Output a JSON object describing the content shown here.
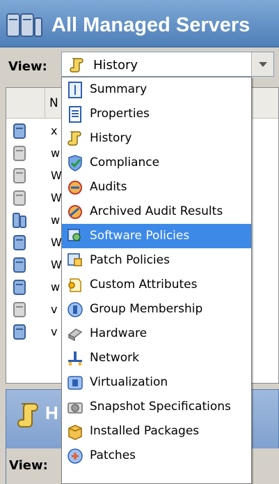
{
  "header": {
    "title": "All Managed Servers"
  },
  "view": {
    "label": "View:",
    "selected": "History"
  },
  "table": {
    "col_name_partial": "N",
    "rows": [
      "x",
      "w",
      "W",
      "W",
      "w",
      "W",
      "W",
      "w",
      "v",
      "v"
    ]
  },
  "dropdown": {
    "items": [
      {
        "label": "Summary",
        "icon": "summary-icon"
      },
      {
        "label": "Properties",
        "icon": "properties-icon"
      },
      {
        "label": "History",
        "icon": "history-icon"
      },
      {
        "label": "Compliance",
        "icon": "compliance-icon"
      },
      {
        "label": "Audits",
        "icon": "audits-icon"
      },
      {
        "label": "Archived Audit Results",
        "icon": "archived-audit-icon"
      },
      {
        "label": "Software Policies",
        "icon": "software-policy-icon"
      },
      {
        "label": "Patch Policies",
        "icon": "patch-policy-icon"
      },
      {
        "label": "Custom Attributes",
        "icon": "custom-attributes-icon"
      },
      {
        "label": "Group Membership",
        "icon": "group-membership-icon"
      },
      {
        "label": "Hardware",
        "icon": "hardware-icon"
      },
      {
        "label": "Network",
        "icon": "network-icon"
      },
      {
        "label": "Virtualization",
        "icon": "virtualization-icon"
      },
      {
        "label": "Snapshot Specifications",
        "icon": "snapshot-icon"
      },
      {
        "label": "Installed Packages",
        "icon": "installed-packages-icon"
      },
      {
        "label": "Patches",
        "icon": "patches-icon"
      }
    ],
    "selected_item": "Software Policies"
  },
  "lower_panel": {
    "title_partial": "H",
    "view_label": "View:"
  },
  "colors": {
    "header_gradient_top": "#7ea8d6",
    "header_gradient_bottom": "#4f7fb8",
    "selection": "#3d89e8",
    "panel_bg": "#d4d0c8"
  }
}
